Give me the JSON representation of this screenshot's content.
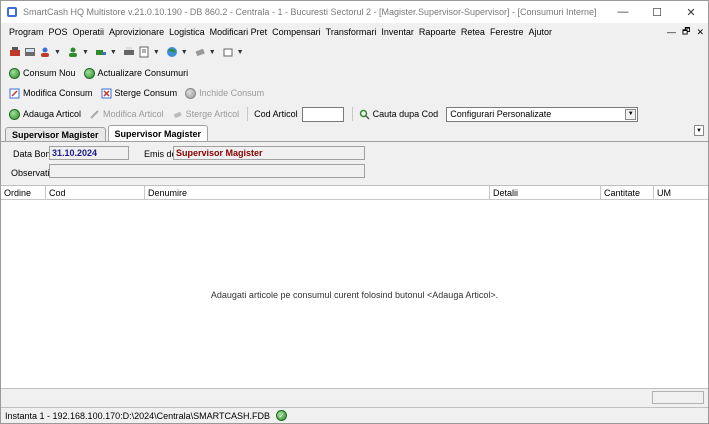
{
  "window": {
    "title": "SmartCash HQ Multistore v.21.0.10.190 - DB 860.2 - Centrala - 1 - Bucuresti Sectorul 2 - [Magister.Supervisor-Supervisor] - [Consumuri Interne]",
    "minimize": "—",
    "maximize": "☐",
    "close": "✕"
  },
  "menu": {
    "items": [
      "Program",
      "POS",
      "Operatii",
      "Aprovizionare",
      "Logistica",
      "Modificari Pret",
      "Compensari",
      "Transformari",
      "Inventar",
      "Rapoarte",
      "Retea",
      "Ferestre",
      "Ajutor"
    ],
    "mdi_min": "—",
    "mdi_restore": "🗗",
    "mdi_close": "✕"
  },
  "toolbar_actions": {
    "consum_nou": "Consum Nou",
    "actualizare": "Actualizare Consumuri",
    "modifica_consum": "Modifica Consum",
    "sterge_consum": "Sterge Consum",
    "inchide_consum": "Inchide Consum",
    "adauga_articol": "Adauga Articol",
    "modifica_articol": "Modifica Articol",
    "sterge_articol": "Sterge Articol",
    "cod_articol_label": "Cod Articol",
    "cod_articol_value": "",
    "cauta_label": "Cauta dupa Cod",
    "config_select": "Configurari Personalizate"
  },
  "tabs": [
    "Supervisor Magister",
    "Supervisor Magister"
  ],
  "form": {
    "data_bon_label": "Data Bon",
    "data_bon_value": "31.10.2024",
    "emis_de_label": "Emis de",
    "emis_de_value": "Supervisor Magister",
    "observatii_label": "Observatii",
    "observatii_value": ""
  },
  "grid": {
    "columns": [
      "Ordine",
      "Cod",
      "Denumire",
      "Detalii",
      "Cantitate",
      "UM"
    ],
    "empty_message": "Adaugati articole pe consumul curent folosind butonul <Adauga Articol>."
  },
  "status": {
    "text": "Instanta 1 - 192.168.100.170:D:\\2024\\Centrala\\SMARTCASH.FDB"
  },
  "colors": {
    "accent_green": "#2e8b2e",
    "date_blue": "#1a1a8c",
    "user_red": "#8b0000"
  }
}
